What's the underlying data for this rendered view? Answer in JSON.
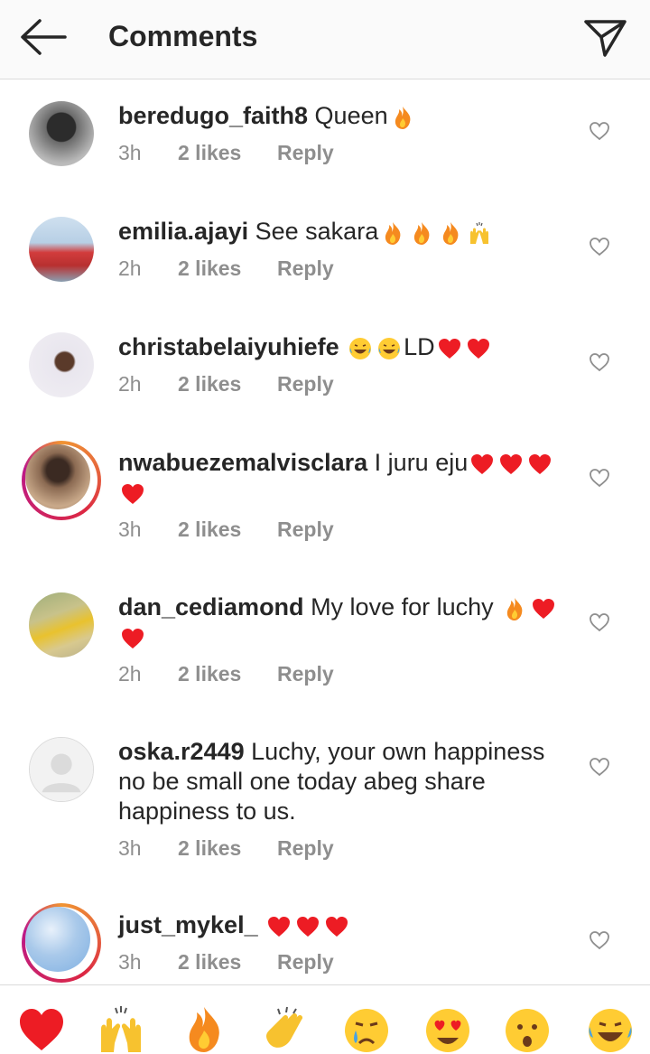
{
  "header": {
    "title": "Comments"
  },
  "comments": [
    {
      "user": "beredugo_faith8",
      "text": "Queen",
      "emojis": [
        "fire"
      ],
      "time": "3h",
      "likes": "2 likes",
      "reply": "Reply"
    },
    {
      "user": "emilia.ajayi",
      "text": "See sakara",
      "emojis": [
        "fire",
        "fire",
        "fire",
        "raising-hands"
      ],
      "time": "2h",
      "likes": "2 likes",
      "reply": "Reply"
    },
    {
      "user": "christabelaiyuhiefe",
      "text": "LD",
      "emojis_before": [
        "laughing",
        "laughing"
      ],
      "emojis": [
        "heart",
        "heart"
      ],
      "time": "2h",
      "likes": "2 likes",
      "reply": "Reply"
    },
    {
      "user": "nwabuezemalvisclara",
      "text": "I juru eju",
      "emojis": [
        "heart",
        "heart",
        "heart",
        "heart"
      ],
      "time": "3h",
      "likes": "2 likes",
      "reply": "Reply"
    },
    {
      "user": "dan_cediamond",
      "text": "My love for luchy",
      "emojis": [
        "fire",
        "heart",
        "heart"
      ],
      "time": "2h",
      "likes": "2 likes",
      "reply": "Reply"
    },
    {
      "user": "oska.r2449",
      "text": "Luchy, your own happiness no be small one today abeg share happiness to us.",
      "emojis": [],
      "time": "3h",
      "likes": "2 likes",
      "reply": "Reply"
    },
    {
      "user": "just_mykel_",
      "text": "",
      "emojis": [
        "heart",
        "heart",
        "heart"
      ],
      "time": "3h",
      "likes": "2 likes",
      "reply": "Reply"
    }
  ],
  "reaction_bar": [
    "heart",
    "raising-hands",
    "fire",
    "clapping-hands",
    "crying-face",
    "heart-eyes",
    "surprised-face",
    "laughing"
  ],
  "colors": {
    "accent_heart": "#ed1c24",
    "meta_gray": "#8e8e8e",
    "text": "#262626"
  }
}
